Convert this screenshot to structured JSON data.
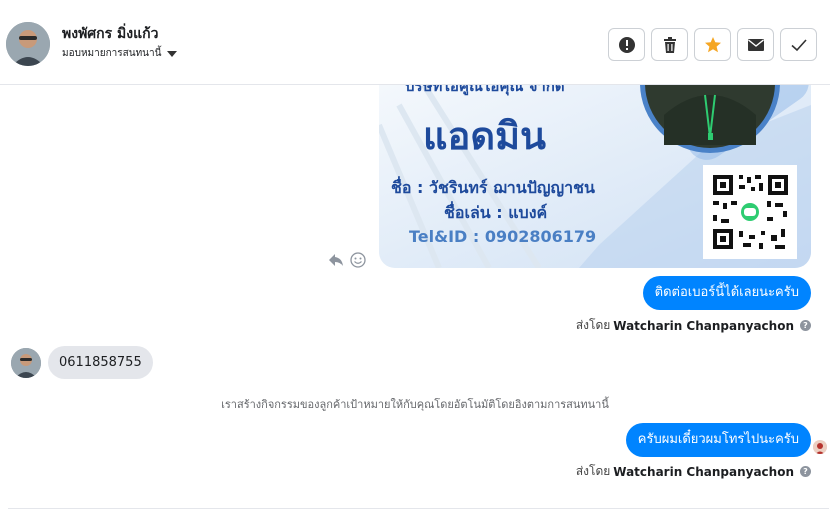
{
  "header": {
    "contact_name": "พงพัศกร มิ่งแก้ว",
    "assign_label": "มอบหมายการสนทนานี้",
    "actions": [
      {
        "name": "spam",
        "icon": "exclamation-circle-icon"
      },
      {
        "name": "delete",
        "icon": "trash-icon"
      },
      {
        "name": "star",
        "icon": "star-icon",
        "color": "#f5a623"
      },
      {
        "name": "mark-unread",
        "icon": "envelope-icon"
      },
      {
        "name": "done",
        "icon": "check-icon"
      }
    ]
  },
  "card": {
    "company": "บริษัทไอคูณไอคุณ จำกัด",
    "role": "แอดมิน",
    "name_line": "ชื่อ : วัชรินทร์ ฌานปัญญาชน",
    "nick_line": "ชื่อเล่น : แบงค์",
    "tel_line": "Tel&ID : 0902806179"
  },
  "messages": {
    "out_1": "ติดต่อเบอร์นี้ได้เลยนะครับ",
    "sent_by_prefix": "ส่งโดย",
    "sent_by_name": "Watcharin Chanpanyachon",
    "in_1": "0611858755",
    "system_note": "เราสร้างกิจกรรมของลูกค้าเป้าหมายให้กับคุณโดยอัตโนมัติโดยอิงตามการสนทนานี้",
    "out_2": "ครับผมเดี๋ยวผมโทรไปนะครับ",
    "help_mark": "?"
  },
  "colors": {
    "accent": "#0084ff",
    "star": "#f5a623",
    "card_text": "#1e4a9c"
  }
}
